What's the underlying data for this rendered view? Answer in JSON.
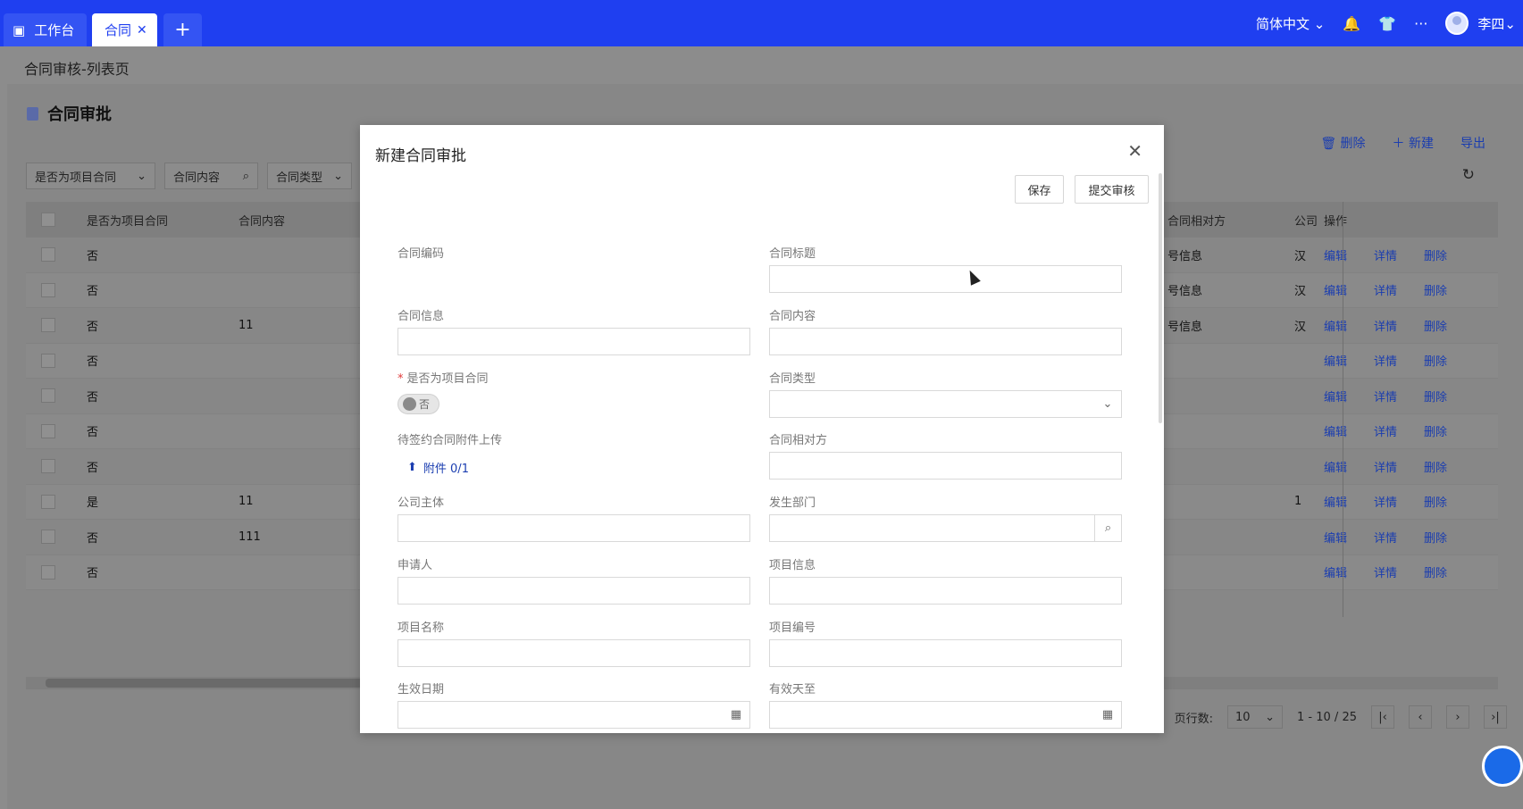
{
  "topbar": {
    "tabs": [
      {
        "label": "工作台",
        "icon": "workbench-icon"
      },
      {
        "label": "合同",
        "icon": "close-icon"
      },
      {
        "label": "+",
        "icon": "plus-icon"
      }
    ],
    "language": "简体中文",
    "user": "李四",
    "icons": [
      "bell-icon",
      "shirt-icon",
      "more-icon",
      "avatar-icon"
    ],
    "colors": {
      "bar": "#1f3ff0",
      "accent": "#1a3db0"
    }
  },
  "page": {
    "breadcrumb": "合同审核-列表页",
    "title": "合同审批",
    "actions": {
      "delete": "删除",
      "new": "新建",
      "export": "导出"
    },
    "filters": [
      {
        "label": "是否为项目合同",
        "icon": "chevron-down-icon"
      },
      {
        "label": "合同内容",
        "icon": "search-icon"
      },
      {
        "label": "合同类型",
        "icon": "chevron-down-icon"
      }
    ],
    "table": {
      "headers": {
        "is_project": "是否为项目合同",
        "content": "合同内容",
        "party": "合同相对方",
        "company": "公司",
        "ops": "操作"
      },
      "rows": [
        {
          "is_project": "否",
          "content": "",
          "party": "号信息",
          "company": "汉⁠",
          "company_num": ""
        },
        {
          "is_project": "否",
          "content": "",
          "party": "号信息",
          "company": "汉",
          "company_num": ""
        },
        {
          "is_project": "否",
          "content": "11",
          "party": "号信息",
          "company": "汉",
          "company_num": ""
        },
        {
          "is_project": "否",
          "content": "",
          "party": "",
          "company": "",
          "company_num": ""
        },
        {
          "is_project": "否",
          "content": "",
          "party": "",
          "company": "",
          "company_num": ""
        },
        {
          "is_project": "否",
          "content": "",
          "party": "",
          "company": "",
          "company_num": ""
        },
        {
          "is_project": "否",
          "content": "",
          "party": "",
          "company": "",
          "company_num": ""
        },
        {
          "is_project": "是",
          "content": "11",
          "party": "",
          "company": "",
          "company_num": "1"
        },
        {
          "is_project": "否",
          "content": "111",
          "party": "",
          "company": "",
          "company_num": ""
        },
        {
          "is_project": "否",
          "content": "",
          "party": "",
          "company": "",
          "company_num": ""
        }
      ],
      "ops": {
        "edit": "编辑",
        "detail": "详情",
        "delete": "删除"
      }
    },
    "pagination": {
      "rows_label": "页行数:",
      "page_size": "10",
      "range": "1 - 10 / 25"
    }
  },
  "modal": {
    "title": "新建合同审批",
    "save": "保存",
    "submit": "提交审核",
    "fields": {
      "code": "合同编码",
      "title": "合同标题",
      "info": "合同信息",
      "content": "合同内容",
      "is_project": "是否为项目合同",
      "is_project_value": "否",
      "type": "合同类型",
      "attachment": "待签约合同附件上传",
      "attachment_btn": "附件 0/1",
      "party": "合同相对方",
      "company": "公司主体",
      "dept": "发生部门",
      "applicant": "申请人",
      "project_info": "项目信息",
      "project_name": "项目名称",
      "project_no": "项目编号",
      "effective_date": "生效日期",
      "valid_until": "有效天至"
    }
  }
}
